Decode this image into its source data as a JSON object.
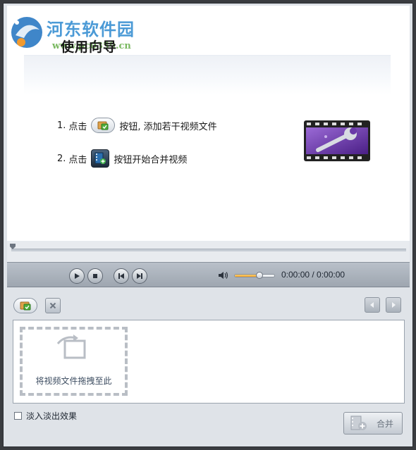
{
  "watermark": {
    "name": "河东软件园",
    "url": "www.pc0359.cn"
  },
  "guide": {
    "title": "使用向导",
    "step1": {
      "num": "1.",
      "prefix": "点击",
      "suffix": "按钮, 添加若干视频文件"
    },
    "step2": {
      "num": "2.",
      "prefix": "点击",
      "suffix": "按钮开始合并视频"
    }
  },
  "player": {
    "time": "0:00:00 / 0:00:00",
    "volume_fraction": 0.62,
    "progress_fraction": 0.0
  },
  "files": {
    "drop_text": "将视频文件拖拽至此"
  },
  "options": {
    "fade_label": "淡入淡出效果",
    "fade_checked": false
  },
  "actions": {
    "merge_label": "合并"
  },
  "colors": {
    "accent_purple": "#6a3aa8",
    "watermark_blue": "#4b9ad6",
    "volume_orange": "#f2a020"
  }
}
